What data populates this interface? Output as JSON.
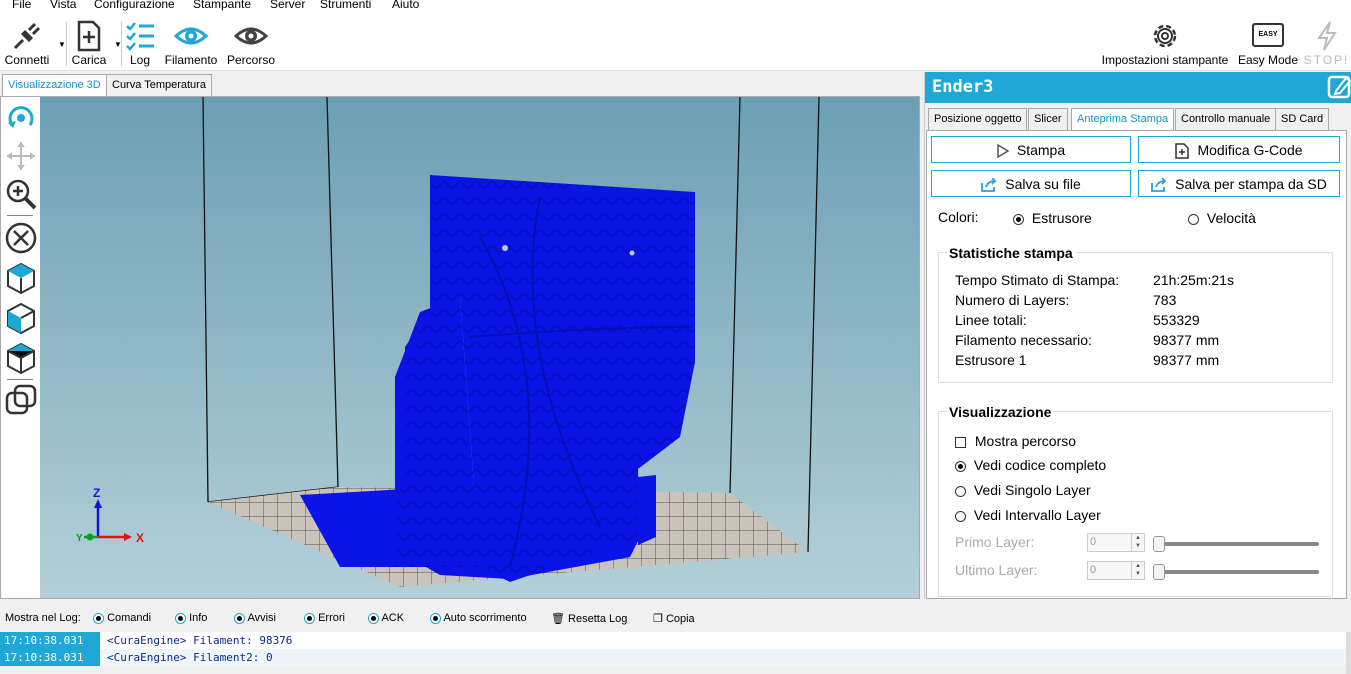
{
  "menu": [
    "File",
    "Vista",
    "Configurazione",
    "Stampante",
    "Server",
    "Strumenti",
    "Aiuto"
  ],
  "toolbar": {
    "connect": "Connetti",
    "load": "Carica",
    "log": "Log",
    "filament": "Filamento",
    "path": "Percorso",
    "printer_settings": "Impostazioni stampante",
    "easy_mode": "Easy Mode",
    "easy_badge": "EASY",
    "stop": "STOP!"
  },
  "view_tabs": [
    "Visualizzazione 3D",
    "Curva Temperatura"
  ],
  "axes": {
    "z": "Z",
    "x": "X",
    "y": "Y"
  },
  "printer_name": "Ender3",
  "right_tabs": [
    "Posizione oggetto",
    "Slicer",
    "Anteprima Stampa",
    "Controllo manuale",
    "SD Card"
  ],
  "actions": {
    "print": "Stampa",
    "edit_gcode": "Modifica G-Code",
    "save_file": "Salva su file",
    "save_sd": "Salva per stampa da SD"
  },
  "colors_label": "Colori:",
  "color_options": {
    "extruder": "Estrusore",
    "speed": "Velocità"
  },
  "stats": {
    "title": "Statistiche stampa",
    "rows": [
      {
        "label": "Tempo Stimato di Stampa:",
        "value": "21h:25m:21s"
      },
      {
        "label": "Numero di Layers:",
        "value": "783"
      },
      {
        "label": "Linee totali:",
        "value": "553329"
      },
      {
        "label": "Filamento necessario:",
        "value": "98377 mm"
      },
      {
        "label": "Estrusore 1",
        "value": "98377 mm"
      }
    ]
  },
  "visual": {
    "title": "Visualizzazione",
    "show_path": "Mostra percorso",
    "full_code": "Vedi codice completo",
    "single_layer": "Vedi Singolo Layer",
    "layer_range": "Vedi Intervallo Layer",
    "first_layer": "Primo Layer:",
    "last_layer": "Ultimo Layer:",
    "first_value": "0",
    "last_value": "0"
  },
  "logbar": {
    "label": "Mostra nel Log:",
    "commands": "Comandi",
    "info": "Info",
    "warnings": "Avvisi",
    "errors": "Errori",
    "ack": "ACK",
    "autoscroll": "Auto scorrimento",
    "reset": "Resetta Log",
    "copy": "Copia"
  },
  "log_lines": [
    {
      "time": "17:10:38.031",
      "msg": "<CuraEngine> Filament: 98376"
    },
    {
      "time": "17:10:38.031",
      "msg": "<CuraEngine> Filament2: 0"
    }
  ],
  "colors": {
    "accent": "#1fa7d6",
    "model": "#0a14e6",
    "link": "#1591c8"
  }
}
